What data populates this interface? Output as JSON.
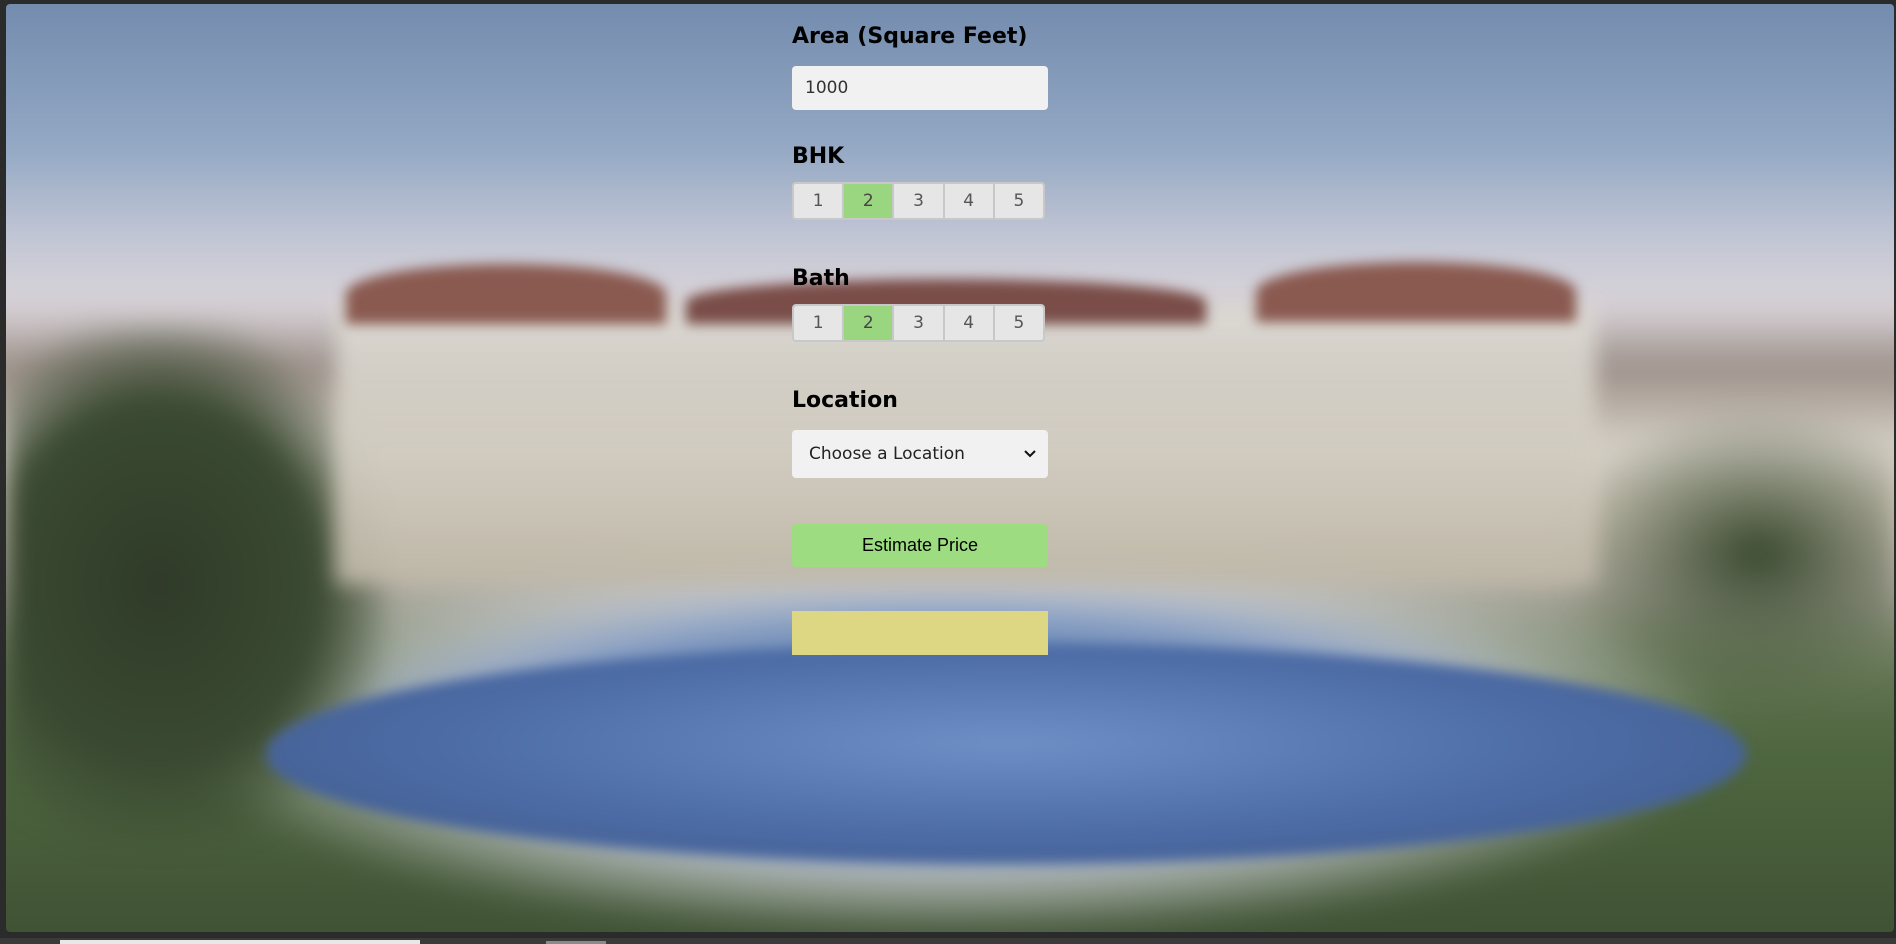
{
  "form": {
    "area": {
      "label": "Area (Square Feet)",
      "value": "1000"
    },
    "bhk": {
      "label": "BHK",
      "options": [
        "1",
        "2",
        "3",
        "4",
        "5"
      ],
      "selected": "2"
    },
    "bath": {
      "label": "Bath",
      "options": [
        "1",
        "2",
        "3",
        "4",
        "5"
      ],
      "selected": "2"
    },
    "location": {
      "label": "Location",
      "selected": "Choose a Location"
    },
    "estimate_button": "Estimate Price",
    "result": ""
  },
  "colors": {
    "segment_active": "#9ad57f",
    "estimate_button": "#9ddc80",
    "result_box": "#ddd683"
  },
  "icons": {
    "select_arrow": "chevron-down-icon"
  }
}
